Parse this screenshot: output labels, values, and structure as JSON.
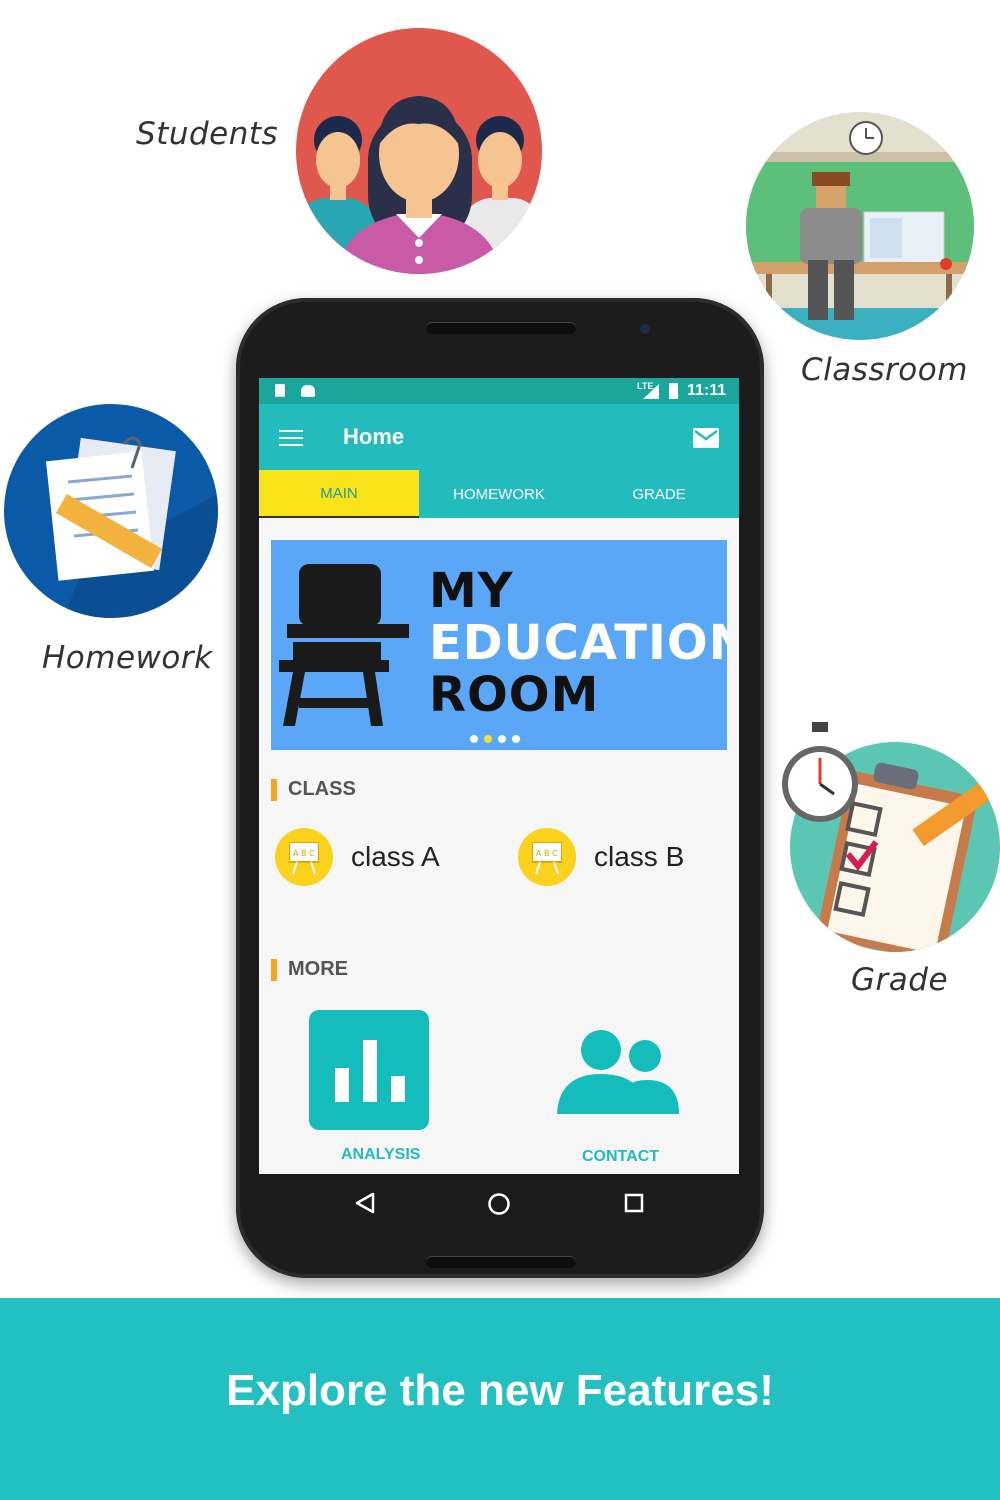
{
  "features": {
    "students": "Students",
    "classroom": "Classroom",
    "homework": "Homework",
    "grade": "Grade"
  },
  "status_bar": {
    "time": "11:11",
    "network": "LTE"
  },
  "app_bar": {
    "title": "Home",
    "menu_icon": "menu-icon",
    "mail_icon": "mail-icon"
  },
  "tabs": [
    {
      "label": "MAIN",
      "active": true
    },
    {
      "label": "HOMEWORK",
      "active": false
    },
    {
      "label": "GRADE",
      "active": false
    }
  ],
  "banner": {
    "line1": "MY",
    "line2": "EDUCATION",
    "line3": "ROOM",
    "slide_count": 4,
    "active_slide": 2
  },
  "class_section": {
    "title": "CLASS",
    "items": [
      {
        "label": "class A"
      },
      {
        "label": "class B"
      }
    ]
  },
  "more_section": {
    "title": "MORE",
    "items": [
      {
        "label": "ANALYSIS",
        "icon": "analysis-icon"
      },
      {
        "label": "CONTACT",
        "icon": "contact-icon"
      }
    ]
  },
  "nav": {
    "back": "back-icon",
    "home": "home-icon",
    "recents": "recents-icon"
  },
  "footer": {
    "text": "Explore the new Features!"
  },
  "colors": {
    "teal": "#23bcbc",
    "status_teal": "#1aa69a",
    "active_tab": "#f9e41a",
    "banner_blue": "#5aa7f7",
    "accent_orange": "#f6a623",
    "class_yellow": "#fbd21b"
  }
}
